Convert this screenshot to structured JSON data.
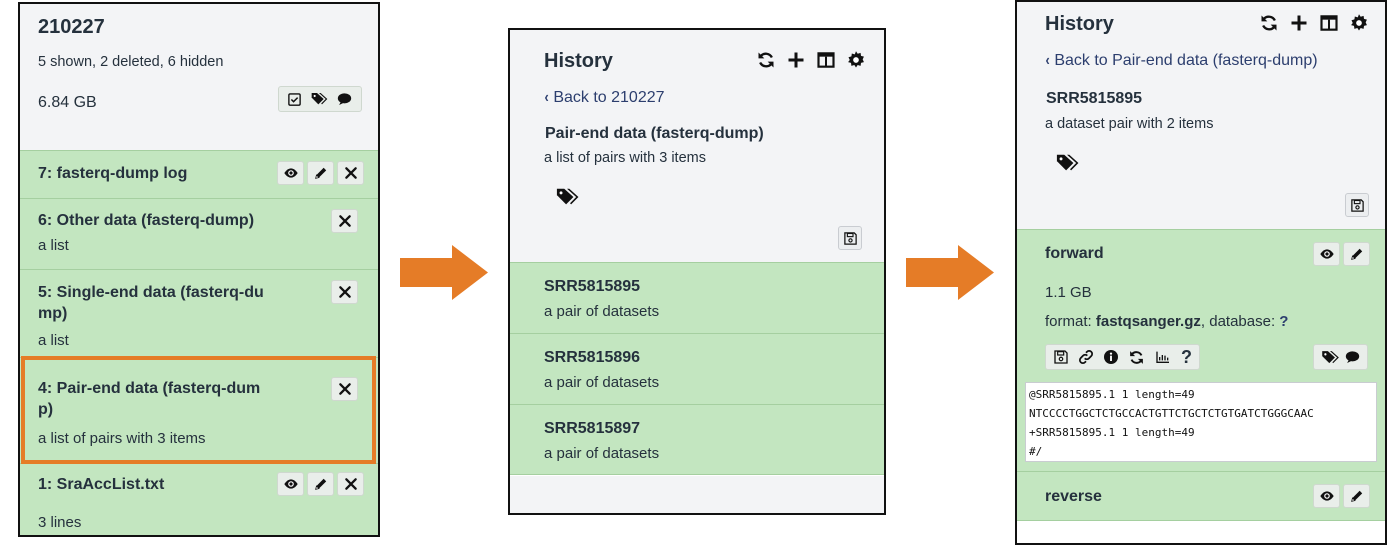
{
  "panel1": {
    "history_name": "210227",
    "summary": "5 shown, 2 deleted, 6 hidden",
    "size": "6.84 GB",
    "header_icons": [
      "checkbox-icon",
      "tags-icon",
      "comment-icon"
    ],
    "datasets": [
      {
        "title": "7: fasterq-dump log",
        "subtitle": "",
        "buttons": [
          "eye-icon",
          "pencil-icon",
          "delete-icon"
        ]
      },
      {
        "title": "6: Other data (fasterq-dump)",
        "subtitle": "a list",
        "buttons": [
          "delete-icon"
        ]
      },
      {
        "title_line1": "5: Single-end data (fasterq-du",
        "title_line2": "mp)",
        "subtitle": "a list",
        "buttons": [
          "delete-icon"
        ]
      },
      {
        "title_line1": "4: Pair-end data (fasterq-dum",
        "title_line2": "p)",
        "subtitle": "a list of pairs with 3 items",
        "buttons": [
          "delete-icon"
        ],
        "highlighted": true
      },
      {
        "title": "1: SraAccList.txt",
        "subtitle": "3 lines",
        "buttons": [
          "eye-icon",
          "pencil-icon",
          "delete-icon"
        ]
      }
    ]
  },
  "panel2": {
    "title": "History",
    "toolbar_icons": [
      "refresh-icon",
      "plus-icon",
      "columns-icon",
      "gear-icon"
    ],
    "back_label": "Back to 210227",
    "collection_name": "Pair-end data (fasterq-dump)",
    "collection_desc": "a list of pairs with 3 items",
    "items": [
      {
        "title": "SRR5815895",
        "subtitle": "a pair of datasets"
      },
      {
        "title": "SRR5815896",
        "subtitle": "a pair of datasets"
      },
      {
        "title": "SRR5815897",
        "subtitle": "a pair of datasets"
      }
    ]
  },
  "panel3": {
    "title": "History",
    "toolbar_icons": [
      "refresh-icon",
      "plus-icon",
      "columns-icon",
      "gear-icon"
    ],
    "back_label": "Back to Pair-end data (fasterq-dump)",
    "pair_name": "SRR5815895",
    "pair_desc": "a dataset pair with 2 items",
    "forward": {
      "title": "forward",
      "size": "1.1 GB",
      "format_label": "format:",
      "format_value": "fastqsanger.gz",
      "database_label": ", database:",
      "database_value": "?",
      "action_icons": [
        "save-icon",
        "link-icon",
        "info-icon",
        "rerun-icon",
        "chart-icon",
        "help-icon"
      ],
      "peek": [
        "@SRR5815895.1 1 length=49",
        "NTCCCCTGGCTCTGCCACTGTTCTGCTCTGTGATCTGGGCAAC",
        "+SRR5815895.1 1 length=49",
        "#/"
      ]
    },
    "reverse": {
      "title": "reverse"
    }
  },
  "colors": {
    "dataset_green": "#c3e6c0",
    "header_gray": "#f3f4f6",
    "highlight_orange": "#e57c27",
    "arrow_orange": "#e57c27",
    "link_blue": "#2c3e6e"
  }
}
